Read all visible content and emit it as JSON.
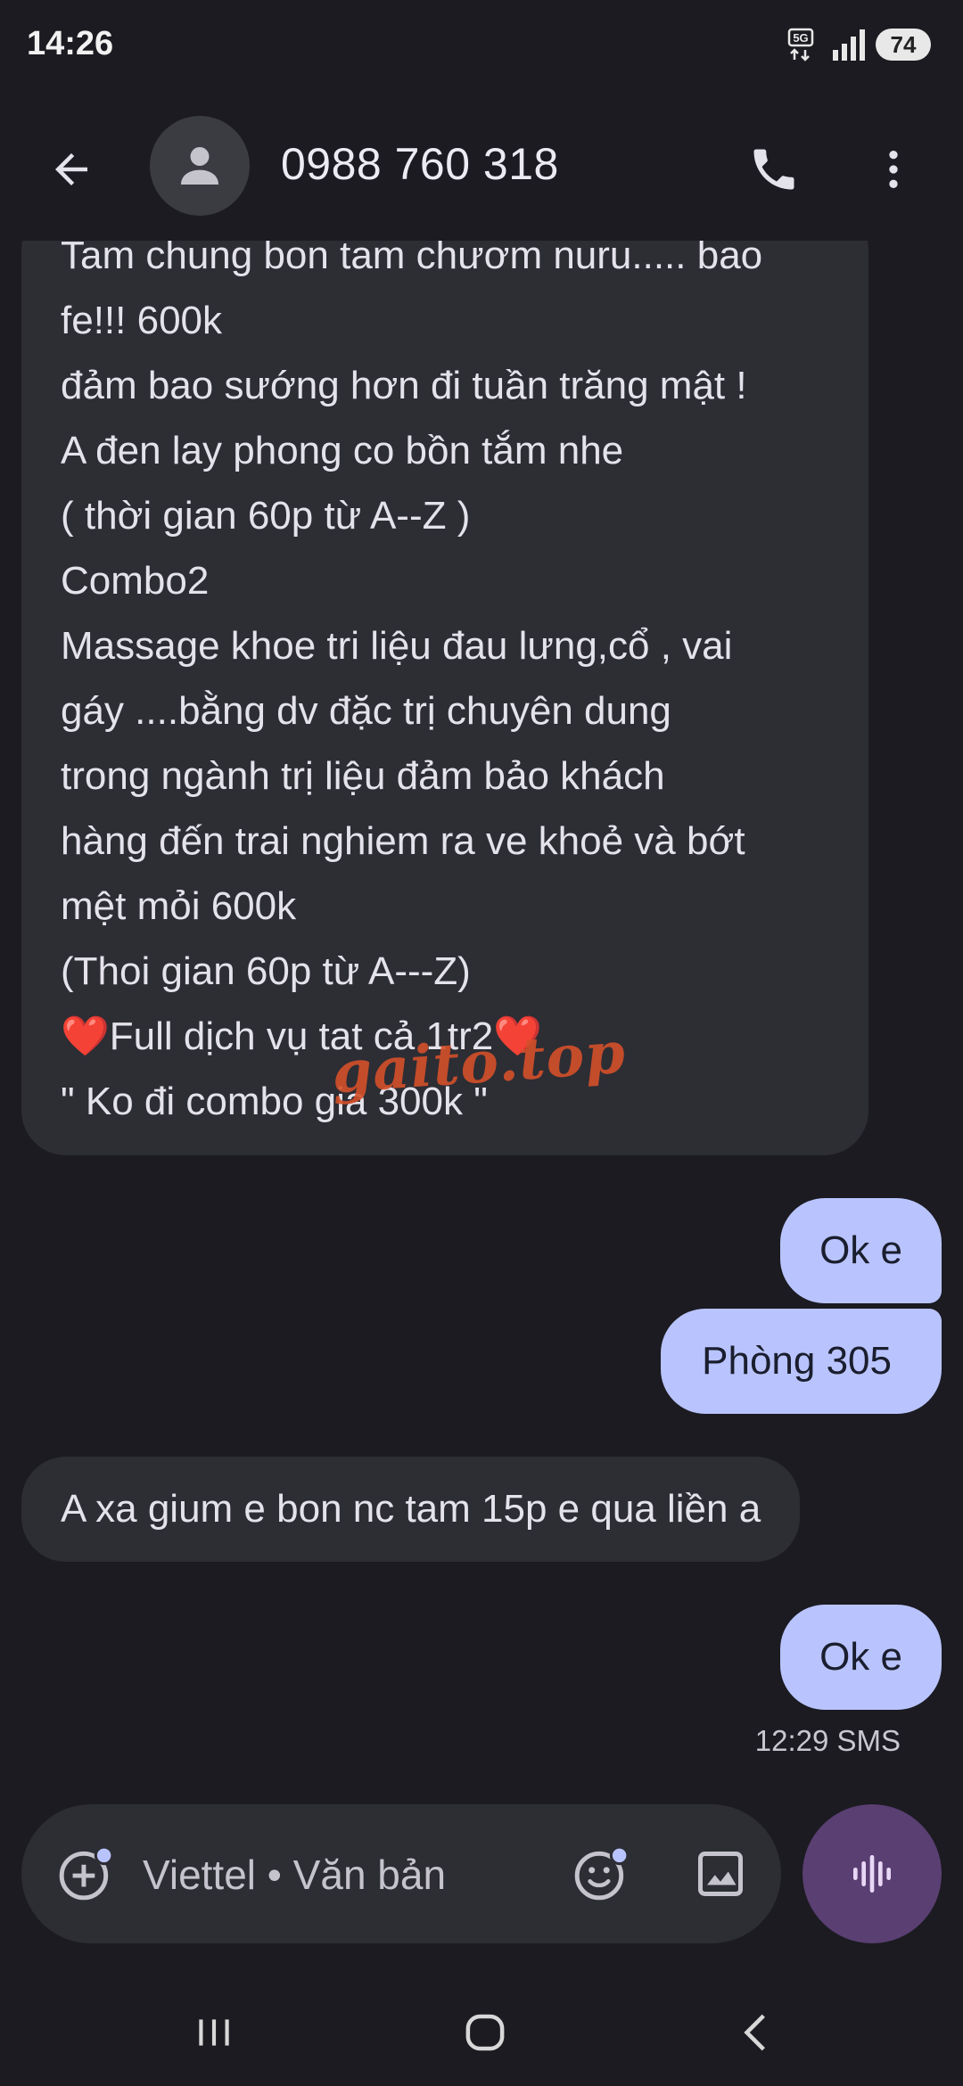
{
  "status_bar": {
    "time": "14:26",
    "network": "5G",
    "battery": "74"
  },
  "header": {
    "title": "0988 760 318"
  },
  "messages": {
    "long_lines": [
      "Tam chung bon tam chươm nuru..... bao",
      "fe!!! 600k",
      "đảm bao sướng hơn đi tuần trăng mật !",
      "A đen lay phong co bồn tắm nhe",
      "( thời gian 60p từ A--Z )",
      "Combo2",
      "Massage khoe tri liệu  đau lưng,cổ , vai",
      "gáy ....bằng dv đặc trị chuyên dung",
      "trong ngành trị liệu đảm bảo khách",
      "hàng đến trai nghiem ra ve khoẻ và bớt",
      "mệt mỏi 600k",
      "(Thoi gian 60p từ A---Z)",
      "❤️Full dịch vụ tat cả 1tr2❤️",
      "\" Ko đi combo gia 300k \""
    ],
    "out1": "Ok e",
    "out2": "Phòng 305",
    "in2": "A xa gium e bon nc tam 15p e qua liền a",
    "out3": "Ok e",
    "timestamp": "12:29 SMS"
  },
  "watermark": "gaito.top",
  "compose": {
    "placeholder": "Viettel • Văn bản"
  },
  "icons": {
    "back": "arrow-back-icon",
    "avatar": "person-icon",
    "call": "phone-icon",
    "more": "more-vert-icon",
    "add": "add-circle-icon",
    "emoji": "emoji-icon",
    "gallery": "image-icon",
    "voice": "voice-wave-icon"
  },
  "colors": {
    "background": "#1b1b21",
    "incoming_bubble": "#2d2d34",
    "outgoing_bubble": "#b9c4ff",
    "voice_button": "#5a3f72",
    "watermark": "#d4502a"
  }
}
